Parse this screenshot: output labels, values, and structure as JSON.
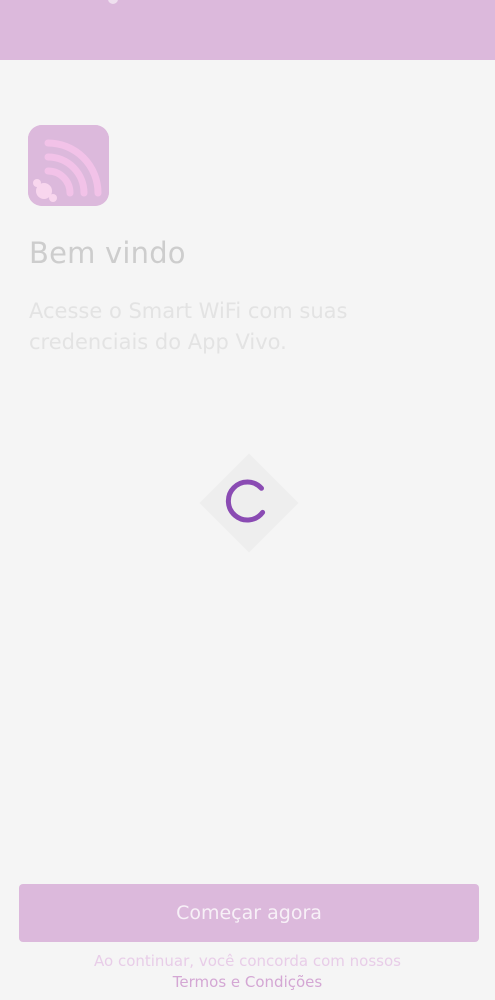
{
  "colors": {
    "header": "#dcb9dc",
    "background": "#f5f5f5",
    "button": "#dcb9dc",
    "spinner": "#8a4bb3",
    "title_text": "#cdcdcd",
    "subtitle_text": "#e3e3e3"
  },
  "logo": {
    "icon": "wifi-pacifier-icon"
  },
  "welcome": {
    "title": "Bem vindo",
    "subtitle": "Acesse o Smart WiFi com suas credenciais do App Vivo."
  },
  "loading": {
    "icon": "loading-spinner-icon"
  },
  "footer": {
    "button_label": "Começar agora",
    "notice": "Ao continuar, você concorda com nossos",
    "terms_link": "Termos e Condições"
  }
}
